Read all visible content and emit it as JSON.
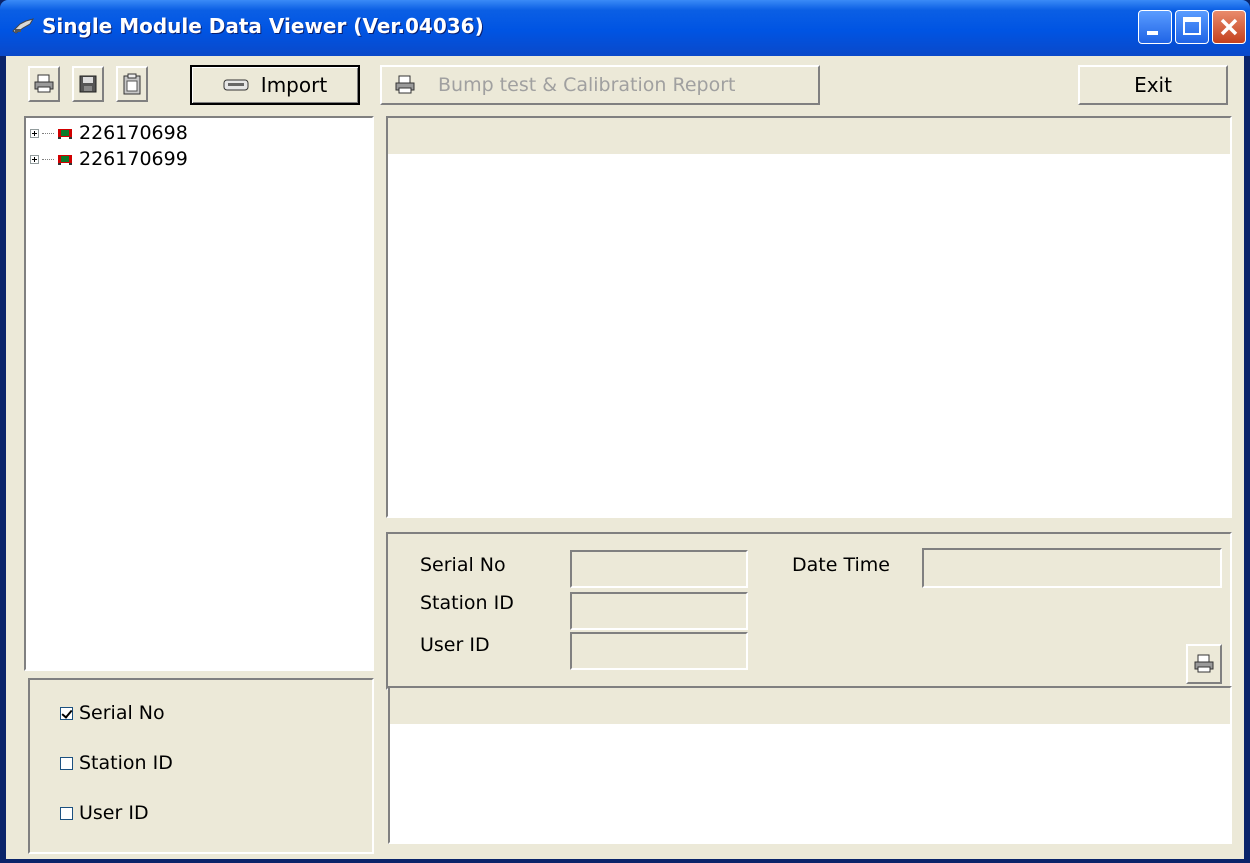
{
  "window": {
    "title": "Single Module Data Viewer (Ver.04036)"
  },
  "toolbar": {
    "import_label": "Import",
    "report_label": "Bump test & Calibration Report",
    "exit_label": "Exit"
  },
  "tree": {
    "items": [
      {
        "label": "226170698"
      },
      {
        "label": "226170699"
      }
    ]
  },
  "filters": {
    "serial_no": {
      "label": "Serial No",
      "checked": true
    },
    "station_id": {
      "label": "Station ID",
      "checked": false
    },
    "user_id": {
      "label": "User ID",
      "checked": false
    }
  },
  "details": {
    "serial_no_label": "Serial No",
    "station_id_label": "Station ID",
    "user_id_label": "User ID",
    "date_time_label": "Date Time",
    "serial_no_value": "",
    "station_id_value": "",
    "user_id_value": "",
    "date_time_value": ""
  },
  "colors": {
    "titlebar": "#0054e3",
    "face": "#ece9d8"
  }
}
